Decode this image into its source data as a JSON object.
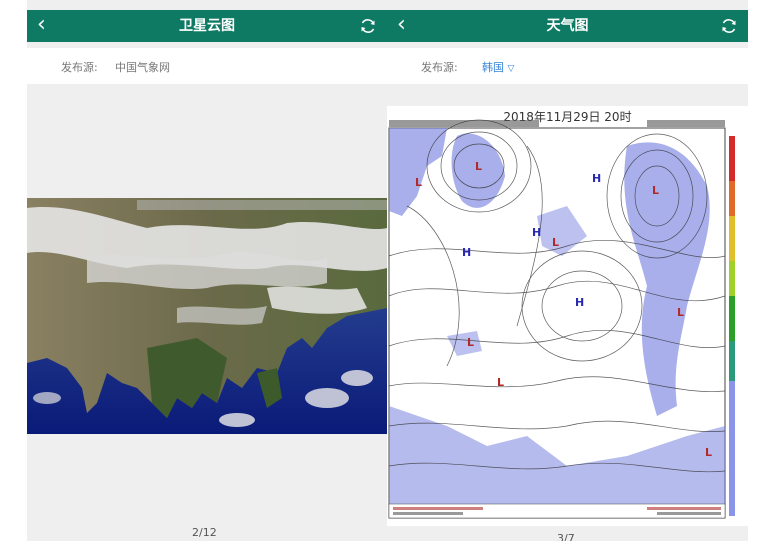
{
  "left_panel": {
    "back_icon": "chevron-left-icon",
    "title": "卫星云图",
    "refresh_icon": "refresh-icon",
    "source_label": "发布源:",
    "source_value": "中国气象网",
    "pager": "2/12"
  },
  "right_panel": {
    "back_icon": "chevron-left-icon",
    "title": "天气图",
    "refresh_icon": "refresh-icon",
    "source_label": "发布源:",
    "source_value": "韩国",
    "dropdown_icon": "triangle-down-icon",
    "chart_title": "2018年11月29日 20时",
    "pager": "3/7"
  },
  "colors": {
    "header_bg": "#0f7a63",
    "dropdown_text": "#3a84d6",
    "page_bg": "#efefef"
  }
}
